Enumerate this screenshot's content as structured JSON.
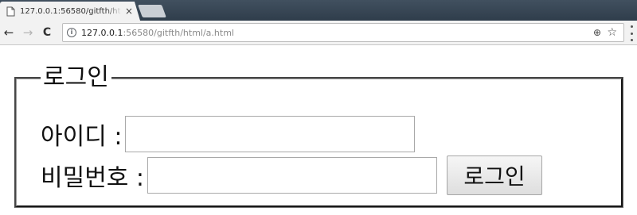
{
  "browser": {
    "tab": {
      "title": "127.0.0.1:56580/gitfth/ht",
      "close_glyph": "×"
    },
    "nav": {
      "back_glyph": "←",
      "forward_glyph": "→",
      "reload_glyph": "C"
    },
    "address": {
      "info_glyph": "i",
      "host": "127.0.0.1",
      "path": ":56580/gitfth/html/a.html"
    },
    "actions": {
      "zoom_glyph": "⊕",
      "star_glyph": "☆"
    }
  },
  "login_form": {
    "legend": "로그인",
    "id_label": "아이디 :",
    "id_value": "",
    "password_label": "비밀번호 :",
    "password_value": "",
    "submit_label": "로그인"
  }
}
